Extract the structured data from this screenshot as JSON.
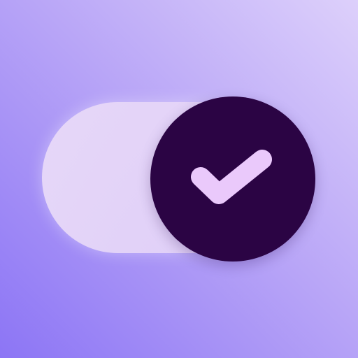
{
  "icon": {
    "name": "toggle-switch-icon",
    "state": "on",
    "colors": {
      "background_light": "#ddd0fb",
      "background_dark": "#8c75f5",
      "track": "#ecdcf8",
      "knob": "#2b0444",
      "check": "#eac9fb"
    }
  }
}
